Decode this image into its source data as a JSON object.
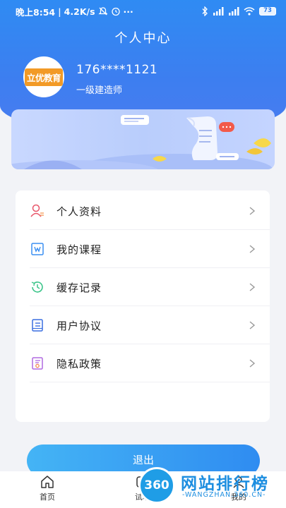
{
  "status_bar": {
    "time": "晚上8:54",
    "speed": "4.2K/s",
    "more": "···",
    "battery": "73"
  },
  "header": {
    "title": "个人中心"
  },
  "profile": {
    "avatar_text": "立优教育",
    "phone": "176****1121",
    "role": "一级建造师"
  },
  "menu": {
    "items": [
      {
        "label": "个人资料",
        "icon": "user-profile-icon"
      },
      {
        "label": "我的课程",
        "icon": "course-icon"
      },
      {
        "label": "缓存记录",
        "icon": "history-icon"
      },
      {
        "label": "用户协议",
        "icon": "agreement-icon"
      },
      {
        "label": "隐私政策",
        "icon": "privacy-icon"
      }
    ]
  },
  "logout_label": "退出",
  "tabbar": {
    "items": [
      {
        "label": "首页",
        "icon": "home-icon"
      },
      {
        "label": "试听",
        "icon": "play-icon"
      },
      {
        "label": "我的",
        "icon": "user-icon"
      }
    ]
  },
  "watermark": {
    "badge": "360",
    "text": "网站排行榜",
    "sub": "-WANGZHAN.360.CN-"
  },
  "colors": {
    "header_blue": "#3a82f2",
    "logout_gradient_start": "#44b4f5",
    "logout_gradient_end": "#2f8cf1",
    "avatar_orange": "#f29a26"
  }
}
